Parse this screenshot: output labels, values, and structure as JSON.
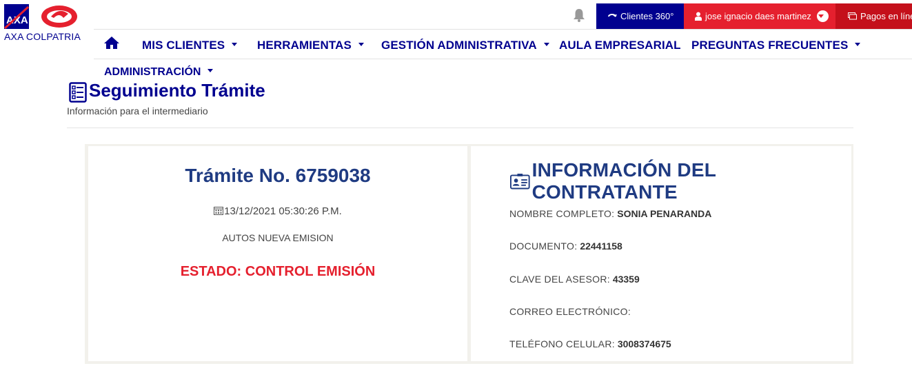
{
  "brand": {
    "name": "AXA COLPATRIA"
  },
  "topbar": {
    "clientes_label": "Clientes 360°",
    "user_name": "jose ignacio daes martinez",
    "pagos_label": "Pagos en línea"
  },
  "nav": {
    "items": [
      {
        "label": "MIS CLIENTES"
      },
      {
        "label": "HERRAMIENTAS"
      },
      {
        "label": "GESTIÓN ADMINISTRATIVA"
      },
      {
        "label": "AULA EMPRESARIAL"
      },
      {
        "label": "PREGUNTAS FRECUENTES"
      },
      {
        "label": "ADMINISTRACIÓN"
      }
    ]
  },
  "page": {
    "title": "Seguimiento Trámite",
    "subtitle": "Información para el intermediario"
  },
  "tramite": {
    "title": "Trámite No. 6759038",
    "fecha": "13/12/2021 05:30:26 P.M.",
    "tipo": "AUTOS NUEVA EMISION",
    "estado": "ESTADO: CONTROL EMISIÓN"
  },
  "contratante": {
    "title": "INFORMACIÓN DEL CONTRATANTE",
    "fields": [
      {
        "label": "NOMBRE COMPLETO:",
        "value": "SONIA PENARANDA"
      },
      {
        "label": "DOCUMENTO:",
        "value": "22441158"
      },
      {
        "label": "CLAVE DEL ASESOR:",
        "value": "43359"
      },
      {
        "label": "CORREO ELECTRÓNICO:",
        "value": ""
      },
      {
        "label": "TELÉFONO CELULAR:",
        "value": "3008374675"
      }
    ]
  },
  "colors": {
    "primary": "#00008f",
    "accent": "#e5202e",
    "title_blue": "#1f3b82"
  },
  "icons": [
    "axa-logo",
    "colpatria-logo",
    "bell-icon",
    "refresh-icon",
    "user-icon",
    "chevron-down-icon",
    "payment-icon",
    "home-icon",
    "checklist-icon",
    "calendar-icon",
    "id-card-icon"
  ]
}
